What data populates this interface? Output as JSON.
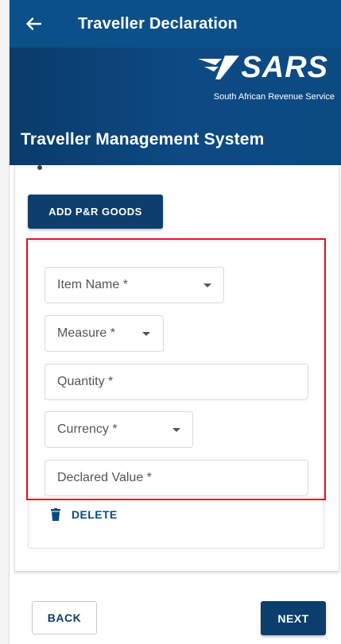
{
  "header": {
    "title": "Traveller Declaration",
    "back_icon": "arrow-left-icon"
  },
  "banner": {
    "logo_text": "SARS",
    "logo_subtitle": "South African Revenue Service",
    "system_title": "Traveller Management System"
  },
  "goods": {
    "add_button_label": "ADD P&R GOODS",
    "fields": {
      "item_name": "Item Name *",
      "measure": "Measure *",
      "quantity": "Quantity *",
      "currency": "Currency *",
      "declared_value": "Declared Value *"
    },
    "delete_label": "DELETE",
    "delete_icon": "trash-icon"
  },
  "footer": {
    "back_label": "BACK",
    "next_label": "NEXT"
  },
  "colors": {
    "primary": "#0c3e6e",
    "appbar": "#0b5088",
    "highlight": "#e0141e"
  }
}
